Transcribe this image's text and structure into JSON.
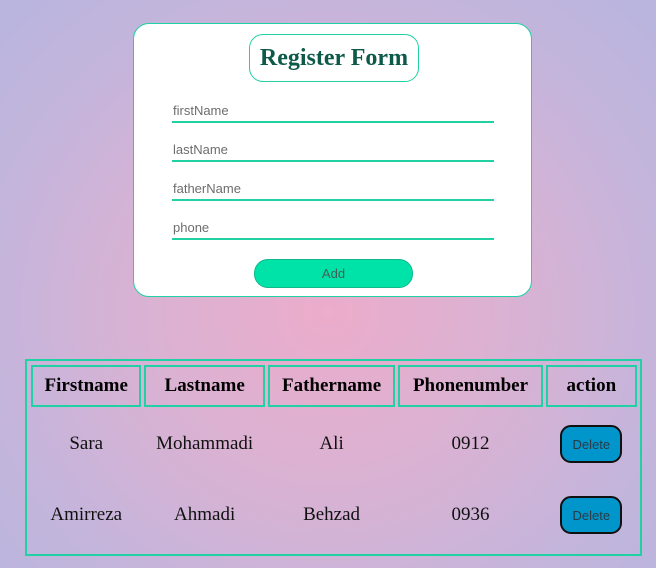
{
  "form": {
    "title": "Register Form",
    "fields": [
      {
        "placeholder": "firstName",
        "value": ""
      },
      {
        "placeholder": "lastName",
        "value": ""
      },
      {
        "placeholder": "fatherName",
        "value": ""
      },
      {
        "placeholder": "phone",
        "value": ""
      }
    ],
    "add_label": "Add"
  },
  "table": {
    "headers": [
      "Firstname",
      "Lastname",
      "Fathername",
      "Phonenumber",
      "action"
    ],
    "rows": [
      {
        "firstname": "Sara",
        "lastname": "Mohammadi",
        "fathername": "Ali",
        "phone": "0912",
        "action_label": "Delete"
      },
      {
        "firstname": "Amirreza",
        "lastname": "Ahmadi",
        "fathername": "Behzad",
        "phone": "0936",
        "action_label": "Delete"
      }
    ]
  },
  "colors": {
    "accent": "#1fd1a3",
    "add_button": "#00e3a8",
    "delete_button": "#0096cc",
    "title_text": "#0e5a4a"
  }
}
